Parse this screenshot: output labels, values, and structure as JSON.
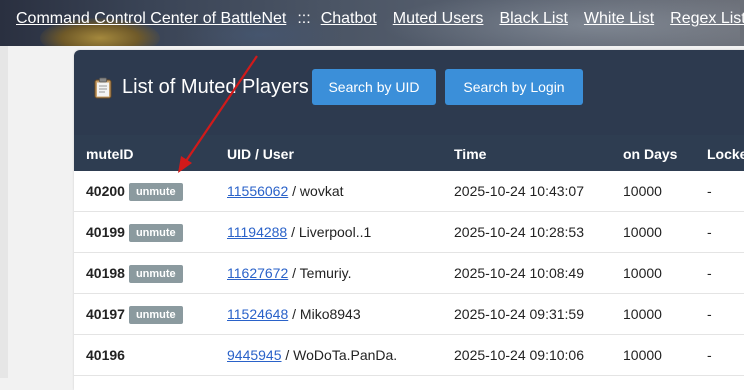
{
  "nav": {
    "title": "Command Control Center of BattleNet",
    "separator": ":::",
    "links": [
      "Chatbot",
      "Muted Users",
      "Black List",
      "White List",
      "Regex List"
    ]
  },
  "card": {
    "title": "List of Muted Players",
    "search_uid": "Search by UID",
    "search_login": "Search by Login"
  },
  "table": {
    "headers": [
      "muteID",
      "UID / User",
      "Time",
      "on Days",
      "Locke"
    ],
    "rows": [
      {
        "id": "40200",
        "action": "unmute",
        "uid": "11556062",
        "user": " / wovkat",
        "time": "2025-10-24 10:43:07",
        "days": "10000",
        "locked": "-"
      },
      {
        "id": "40199",
        "action": "unmute",
        "uid": "11194288",
        "user": " / Liverpool..1",
        "time": "2025-10-24 10:28:53",
        "days": "10000",
        "locked": "-"
      },
      {
        "id": "40198",
        "action": "unmute",
        "uid": "11627672",
        "user": " / Temuriy.",
        "time": "2025-10-24 10:08:49",
        "days": "10000",
        "locked": "-"
      },
      {
        "id": "40197",
        "action": "unmute",
        "uid": "11524648",
        "user": " / Miko8943",
        "time": "2025-10-24 09:31:59",
        "days": "10000",
        "locked": "-"
      },
      {
        "id": "40196",
        "action": "",
        "uid": "9445945",
        "user": " / WoDoTa.PanDa.",
        "time": "2025-10-24 09:10:06",
        "days": "10000",
        "locked": "-"
      }
    ]
  },
  "colors": {
    "header": "#2d3a4f",
    "button": "#3b8fd9",
    "badge": "#8b9a9f",
    "link": "#2a62c9",
    "arrow": "#d11a1a"
  }
}
